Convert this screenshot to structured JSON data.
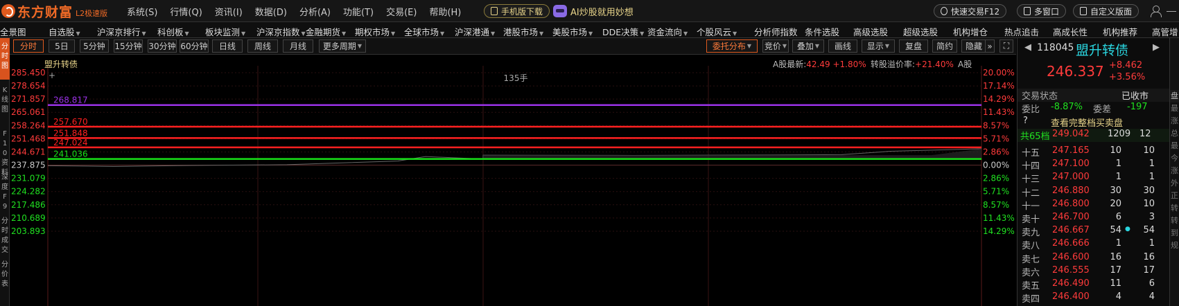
{
  "app": {
    "logo_text": "东方财富",
    "logo_sub": "L2极速版",
    "menu": [
      "系统(S)",
      "行情(Q)",
      "资讯(I)",
      "数据(D)",
      "分析(A)",
      "功能(T)",
      "交易(E)",
      "帮助(H)"
    ],
    "mobile_download": "手机版下载",
    "ai_text": "AI炒股就用妙想",
    "quick_trade": "快速交易F12",
    "multi_window": "多窗口",
    "custom_layout": "自定义版面"
  },
  "nav": [
    {
      "label": "全景图",
      "arrow": false
    },
    {
      "label": "自选股",
      "arrow": true
    },
    {
      "label": "沪深京排行",
      "arrow": true
    },
    {
      "label": "科创板",
      "arrow": true
    },
    {
      "label": "板块监测",
      "arrow": true
    },
    {
      "label": "沪深京指数",
      "arrow": true
    },
    {
      "label": "金融期货",
      "arrow": true
    },
    {
      "label": "期权市场",
      "arrow": true
    },
    {
      "label": "全球市场",
      "arrow": true
    },
    {
      "label": "沪深港通",
      "arrow": true
    },
    {
      "label": "港股市场",
      "arrow": true
    },
    {
      "label": "美股市场",
      "arrow": true
    },
    {
      "label": "DDE决策",
      "arrow": true
    },
    {
      "label": "资金流向",
      "arrow": true
    },
    {
      "label": "个股风云",
      "arrow": true
    },
    {
      "label": "分析师指数",
      "arrow": false
    },
    {
      "label": "条件选股",
      "arrow": false
    },
    {
      "label": "高级选股",
      "arrow": false
    },
    {
      "label": "超级选股",
      "arrow": false
    },
    {
      "label": "机构增仓",
      "arrow": false
    },
    {
      "label": "热点追击",
      "arrow": false
    },
    {
      "label": "高成长性",
      "arrow": false
    },
    {
      "label": "机构推荐",
      "arrow": false
    },
    {
      "label": "高管增",
      "arrow": false
    }
  ],
  "left_tabs": [
    {
      "label": "分时图",
      "active": true
    },
    {
      "label": "K线图",
      "active": false
    },
    {
      "label": "F10资料",
      "active": false
    },
    {
      "label": "深度F9",
      "active": false
    },
    {
      "label": "分时成交",
      "active": false
    },
    {
      "label": "分价表",
      "active": false
    }
  ],
  "periods": [
    "分时",
    "5日",
    "5分钟",
    "15分钟",
    "30分钟",
    "60分钟",
    "日线",
    "周线",
    "月线",
    "更多周期"
  ],
  "chart_tools": [
    "委托分布",
    "竞价",
    "叠加",
    "画线",
    "显示",
    "复盘",
    "简约",
    "隐藏"
  ],
  "chart": {
    "stock_name": "盟升转债",
    "volume_note": "135手",
    "a_latest_label": "A股最新:",
    "a_latest_value": "42.49",
    "a_latest_change": "+1.80%",
    "premium_label": "转股溢价率:",
    "premium_value": "+21.40%",
    "a_share_label": "A股",
    "left_axis": [
      "285.450",
      "278.654",
      "271.857",
      "265.061",
      "258.264",
      "251.468",
      "244.671",
      "237.875",
      "231.079",
      "224.282",
      "217.486",
      "210.689",
      "203.893"
    ],
    "right_axis": [
      "20.00%",
      "17.14%",
      "14.29%",
      "11.43%",
      "8.57%",
      "5.71%",
      "2.86%",
      "0.00%",
      "2.86%",
      "5.71%",
      "8.57%",
      "11.43%",
      "14.29%"
    ],
    "levels": [
      {
        "value": "268.817",
        "color": "#9a32e8"
      },
      {
        "value": "257.670",
        "color": "#ff2020"
      },
      {
        "value": "251.848",
        "color": "#ff2020"
      },
      {
        "value": "247.024",
        "color": "#ff2020"
      },
      {
        "value": "241.036",
        "color": "#18e018"
      }
    ]
  },
  "quote": {
    "code": "118045",
    "name": "盟升转债",
    "price": "246.337",
    "change": "+8.462",
    "change_pct": "+3.56%",
    "trade_status_label": "交易状态",
    "trade_status": "已收市",
    "weibi_label": "委比",
    "weibi": "-8.87%",
    "weicha_label": "委差",
    "weicha": "-197",
    "full_book": "查看完整档买卖盘",
    "total_levels_label": "共65档",
    "total_levels_price": "249.042",
    "total_levels_vol": "1209",
    "total_levels_cnt": "12",
    "asks": [
      {
        "label": "十五",
        "price": "247.165",
        "vol": "10",
        "cnt": "10"
      },
      {
        "label": "十四",
        "price": "247.100",
        "vol": "1",
        "cnt": "1"
      },
      {
        "label": "十三",
        "price": "247.000",
        "vol": "1",
        "cnt": "1"
      },
      {
        "label": "十二",
        "price": "246.880",
        "vol": "30",
        "cnt": "30"
      },
      {
        "label": "十一",
        "price": "246.800",
        "vol": "20",
        "cnt": "10"
      },
      {
        "label": "卖十",
        "price": "246.700",
        "vol": "6",
        "cnt": "3"
      },
      {
        "label": "卖九",
        "price": "246.667",
        "vol": "54",
        "cnt": "54"
      },
      {
        "label": "卖八",
        "price": "246.666",
        "vol": "1",
        "cnt": "1"
      },
      {
        "label": "卖七",
        "price": "246.600",
        "vol": "16",
        "cnt": "16"
      },
      {
        "label": "卖六",
        "price": "246.555",
        "vol": "17",
        "cnt": "17"
      },
      {
        "label": "卖五",
        "price": "246.490",
        "vol": "11",
        "cnt": "6"
      },
      {
        "label": "卖四",
        "price": "246.400",
        "vol": "4",
        "cnt": "4"
      }
    ]
  },
  "side_text": [
    "最",
    "涨",
    "总",
    "最",
    "今",
    "涨",
    "外",
    "正",
    "转",
    "转",
    "到",
    "规"
  ]
}
